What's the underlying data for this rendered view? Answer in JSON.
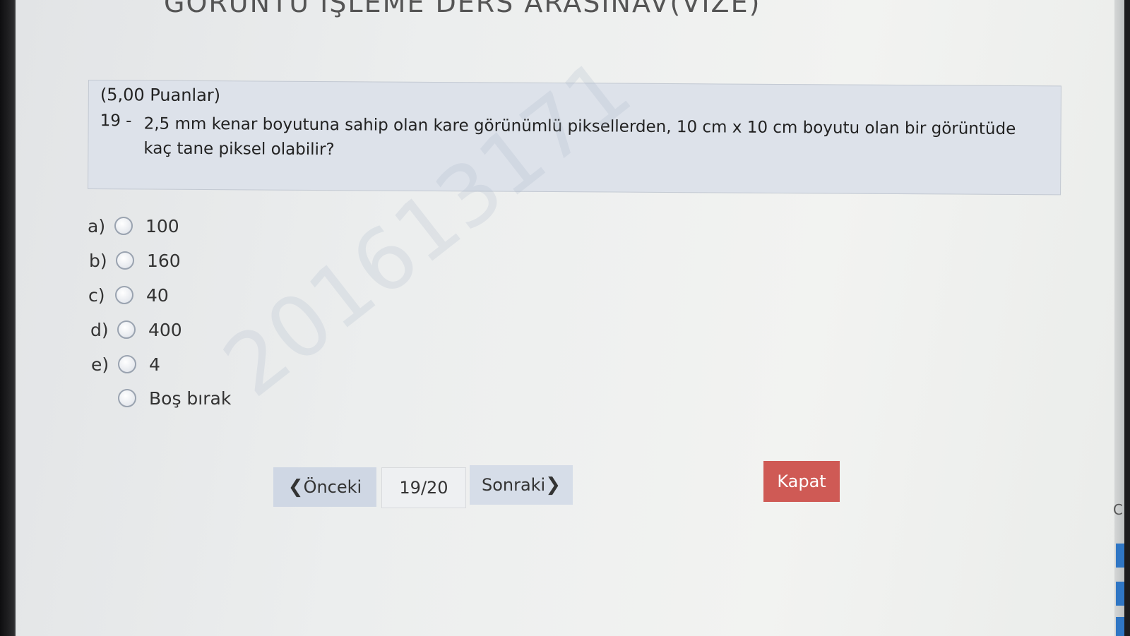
{
  "exam": {
    "title": "GÖRÜNTÜ İŞLEME DERS ARASINAV(VİZE)"
  },
  "question": {
    "points": "(5,00 Puanlar)",
    "number": "19 -",
    "text": "2,5 mm kenar boyutuna sahip olan kare görünümlü piksellerden, 10 cm x 10 cm boyutu olan bir görüntüde kaç tane piksel olabilir?"
  },
  "options": [
    {
      "letter": "a)",
      "value": "100"
    },
    {
      "letter": "b)",
      "value": "160"
    },
    {
      "letter": "c)",
      "value": "40"
    },
    {
      "letter": "d)",
      "value": "400"
    },
    {
      "letter": "e)",
      "value": "4"
    },
    {
      "letter": "",
      "value": "Boş bırak"
    }
  ],
  "watermark": "201613171",
  "navigation": {
    "prev_label": "Önceki",
    "page_indicator": "19/20",
    "next_label": "Sonraki",
    "close_label": "Kapat"
  },
  "edge": {
    "letter": "C"
  },
  "colors": {
    "panel": "#dde2ea",
    "close_button": "#cf5a55",
    "prev_button": "#cfd7e4",
    "accent_blue": "#2f76c4"
  }
}
